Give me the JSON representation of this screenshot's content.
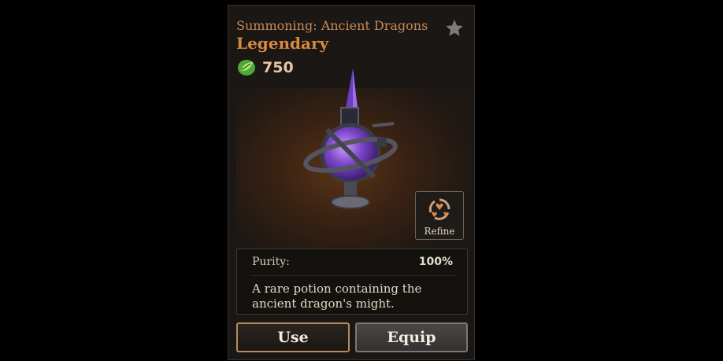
{
  "item": {
    "title": "Summoning: Ancient Dragons",
    "rarity": "Legendary",
    "price": "750",
    "price_icon": "green-gem-icon",
    "favorite_icon": "star-icon"
  },
  "refine": {
    "label": "Refine",
    "icon": "refine-cycle-icon"
  },
  "stats": {
    "purity_label": "Purity:",
    "purity_value": "100%"
  },
  "description": "A rare potion containing the ancient dragon's might.",
  "actions": {
    "use_label": "Use",
    "equip_label": "Equip"
  },
  "colors": {
    "title": "#c98a55",
    "rarity": "#d9893f",
    "price": "#e6c79e",
    "use_border": "#b8895d",
    "equip_border": "#7a7673"
  }
}
